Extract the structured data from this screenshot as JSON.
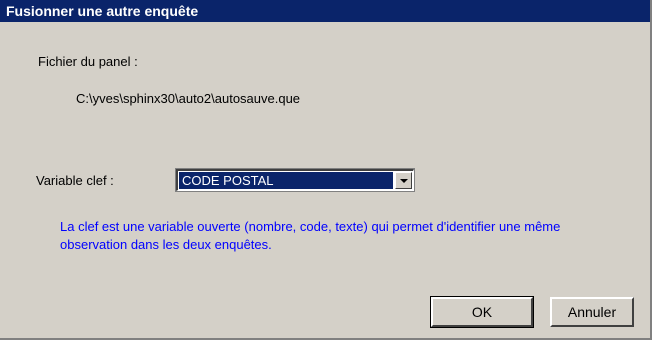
{
  "window": {
    "title": "Fusionner une autre enquête"
  },
  "panel": {
    "label": "Fichier du panel :",
    "path": "C:\\yves\\sphinx30\\auto2\\autosauve.que"
  },
  "key": {
    "label": "Variable clef :",
    "selected": "CODE POSTAL"
  },
  "info": {
    "text": "La clef est une variable ouverte (nombre, code, texte) qui permet d'identifier une même observation dans les deux enquêtes."
  },
  "buttons": {
    "ok_label": "OK",
    "cancel_label": "Annuler"
  }
}
